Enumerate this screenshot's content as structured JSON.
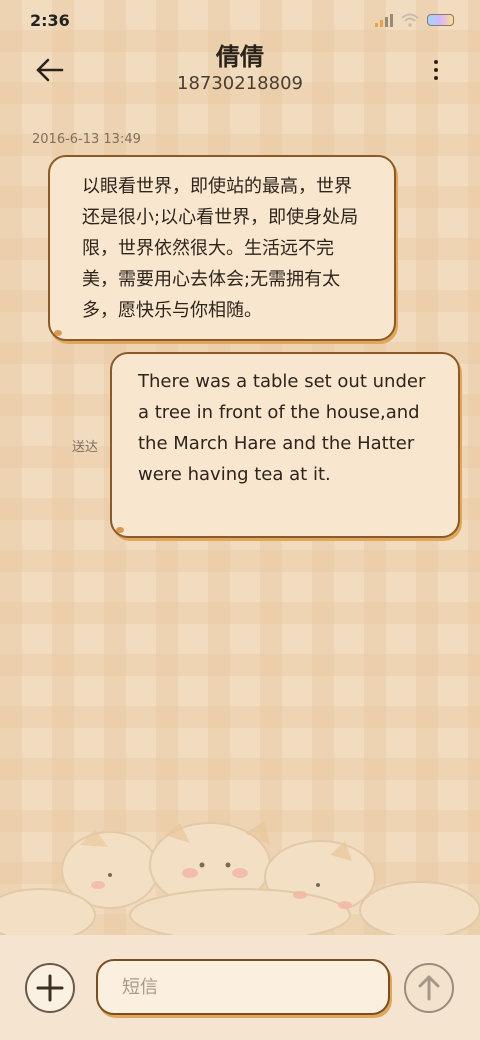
{
  "status_bar": {
    "time": "2:36",
    "signal_icon": "cellular-signal-icon",
    "wifi_icon": "wifi-icon",
    "battery_icon": "battery-icon"
  },
  "header": {
    "back_icon": "arrow-left-icon",
    "contact_name": "倩倩",
    "contact_number": "18730218809",
    "menu_icon": "more-vertical-icon"
  },
  "conversation": {
    "timestamp": "2016-6-13 13:49",
    "received_message": "以眼看世界，即使站的最高，世界还是很小;以心看世界，即使身处局限，世界依然很大。生活远不完美，需要用心去体会;无需拥有太多，愿快乐与你相随。",
    "sent_message": "There was a table set out under a tree in front of the house,and the March Hare and the Hatter were having tea at it.",
    "sent_status": "送达"
  },
  "composer": {
    "add_icon": "plus-circle-icon",
    "placeholder": "短信",
    "value": "",
    "send_icon": "arrow-up-icon"
  },
  "theme": {
    "background": "#f2dcc0",
    "bubble_fill": "#f9e6cf",
    "bubble_border": "#8a5a2a",
    "bubble_shadow": "#e0a75a"
  }
}
